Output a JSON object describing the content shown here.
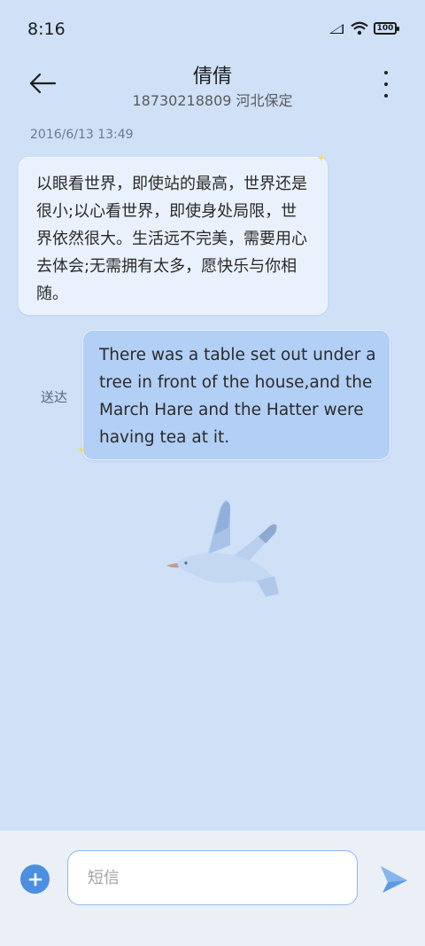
{
  "status_bar": {
    "time": "8:16",
    "battery": "100",
    "icons": [
      "signal-icon",
      "wifi-icon",
      "battery-icon"
    ]
  },
  "header": {
    "contact_name": "倩倩",
    "contact_detail": "18730218809 河北保定",
    "back_icon": "arrow-left-icon",
    "more_icon": "vertical-dots-icon"
  },
  "conversation": {
    "timestamp": "2016/6/13 13:49",
    "incoming_message": "以眼看世界，即使站的最高，世界还是很小;以心看世界，即使身处局限，世界依然很大。生活远不完美，需要用心去体会;无需拥有太多，愿快乐与你相随。",
    "outgoing_message": "There was a table set out under a tree in front of the house,and the March Hare and the Hatter were having tea at it.",
    "delivery_status": "送达"
  },
  "composer": {
    "placeholder": "短信",
    "add_icon": "plus-icon",
    "send_icon": "paper-plane-icon"
  },
  "colors": {
    "background": "#cfe0f7",
    "incoming_bubble": "#e9f1fc",
    "outgoing_bubble": "#b2cff5",
    "accent": "#4c8fe0"
  }
}
